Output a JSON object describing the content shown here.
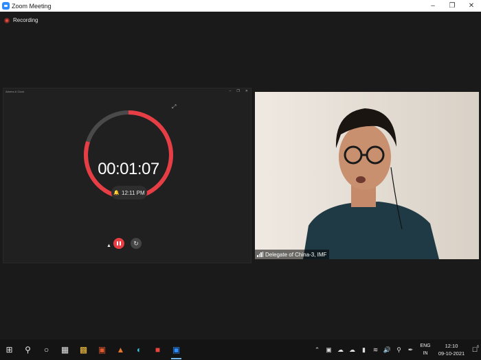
{
  "window": {
    "title": "Zoom Meeting"
  },
  "recording": {
    "label": "Recording"
  },
  "shared_app": {
    "window_title": "Alarms & Clock",
    "stopwatch_time": "00:01:07",
    "alarm_time": "12:11 PM",
    "progress_fraction": 0.8,
    "ring_color": "#e63e44",
    "track_color": "#4a4a4a"
  },
  "video": {
    "participant_name": "Delegate of China-3, IMF"
  },
  "taskbar": {
    "language_top": "ENG",
    "language_bottom": "IN",
    "clock_time": "12:10",
    "clock_date": "09-10-2021",
    "notification_count": "6"
  },
  "colors": {
    "zoom_blue": "#2d8cff",
    "record_red": "#e24b3e",
    "taskbar_bg": "#141414",
    "active_indicator": "#76b9ed"
  }
}
